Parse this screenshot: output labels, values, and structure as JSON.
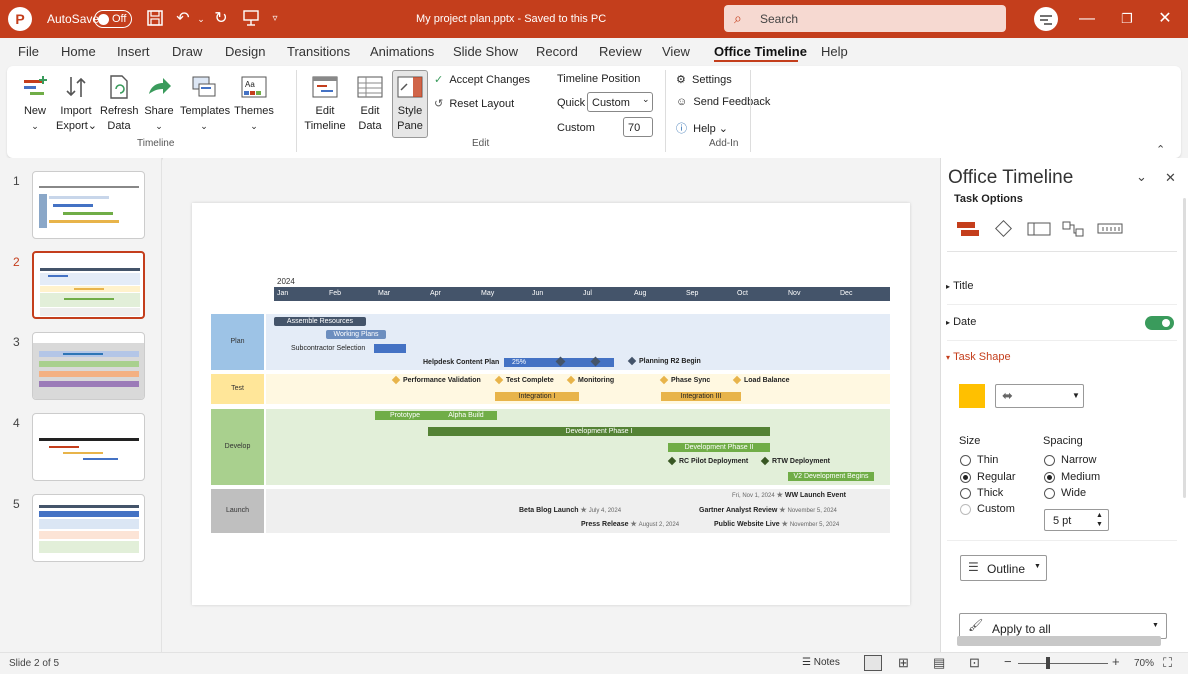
{
  "titlebar": {
    "logo": "P",
    "autosave_label": "AutoSave",
    "autosave_state": "Off",
    "doc_title": "My project plan.pptx - Saved to this PC",
    "search_placeholder": "Search"
  },
  "menu": [
    "File",
    "Home",
    "Insert",
    "Draw",
    "Design",
    "Transitions",
    "Animations",
    "Slide Show",
    "Record",
    "Review",
    "View",
    "Office Timeline",
    "Help"
  ],
  "menu_active": "Office Timeline",
  "ribbon": {
    "timeline_group": {
      "new": "New",
      "import": "Import",
      "export": "Export",
      "refresh": "Refresh",
      "data": "Data",
      "share": "Share",
      "templates": "Templates",
      "themes": "Themes",
      "label": "Timeline"
    },
    "edit_group": {
      "edit": "Edit",
      "timeline": "Timeline",
      "data": "Data",
      "style": "Style",
      "pane": "Pane",
      "accept_changes": "Accept Changes",
      "reset_layout": "Reset Layout",
      "timeline_position": "Timeline Position",
      "quick_label": "Quick",
      "quick_value": "Custom",
      "custom_label": "Custom",
      "custom_value": "70",
      "label": "Edit"
    },
    "addin_group": {
      "settings": "Settings",
      "feedback": "Send Feedback",
      "help": "Help",
      "label": "Add-In"
    }
  },
  "slides": [
    "1",
    "2",
    "3",
    "4",
    "5"
  ],
  "active_slide": 2,
  "timeline": {
    "year": "2024",
    "months": [
      "Jan",
      "Feb",
      "Mar",
      "Apr",
      "May",
      "Jun",
      "Jul",
      "Aug",
      "Sep",
      "Oct",
      "Nov",
      "Dec"
    ],
    "lanes": {
      "plan": "Plan",
      "test": "Test",
      "develop": "Develop",
      "launch": "Launch"
    },
    "plan_tasks": {
      "assemble": "Assemble Resources",
      "working": "Working Plans",
      "subcontractor": "Subcontractor Selection",
      "helpdesk": "Helpdesk Content Plan",
      "helpdesk_pct": "25%",
      "planning": "Planning R2 Begin"
    },
    "test_tasks": {
      "perf": "Performance Validation",
      "complete": "Test Complete",
      "monitoring": "Monitoring",
      "phase_sync": "Phase Sync",
      "load": "Load Balance",
      "int1": "Integration I",
      "int3": "Integration III"
    },
    "dev_tasks": {
      "prototype": "Prototype",
      "alpha": "Alpha Build",
      "dev1": "Development Phase I",
      "dev2": "Development Phase II",
      "rc": "RC Pilot Deployment",
      "rtw": "RTW Deployment",
      "v2": "V2 Development Begins"
    },
    "launch_tasks": {
      "ww_date": "Fri, Nov 1, 2024",
      "ww": "WW Launch Event",
      "beta": "Beta Blog Launch",
      "beta_date": "July 4, 2024",
      "gartner": "Gartner Analyst Review",
      "gartner_date": "November 5, 2024",
      "press": "Press Release",
      "press_date": "August 2, 2024",
      "public": "Public Website Live",
      "public_date": "November 5, 2024"
    }
  },
  "pane": {
    "title": "Office Timeline",
    "subtitle": "Task Options",
    "sections": {
      "title": "Title",
      "date": "Date",
      "task_shape": "Task Shape"
    },
    "color": "#ffc000",
    "size_label": "Size",
    "size_options": [
      "Thin",
      "Regular",
      "Thick",
      "Custom"
    ],
    "size_selected": "Regular",
    "spacing_label": "Spacing",
    "spacing_options": [
      "Narrow",
      "Medium",
      "Wide"
    ],
    "spacing_selected": "Medium",
    "spacing_value": "5 pt",
    "outline": "Outline",
    "apply_all": "Apply to all"
  },
  "status": {
    "slide": "Slide 2 of 5",
    "notes": "Notes",
    "zoom": "70%"
  },
  "colors": {
    "accent": "#c43e1c",
    "toggle_on": "#3a9b5c",
    "header_bar": "#44546a",
    "plan_bar": "#4472c4",
    "test_bar": "#e8b44a",
    "dev_bar": "#70ad47"
  }
}
